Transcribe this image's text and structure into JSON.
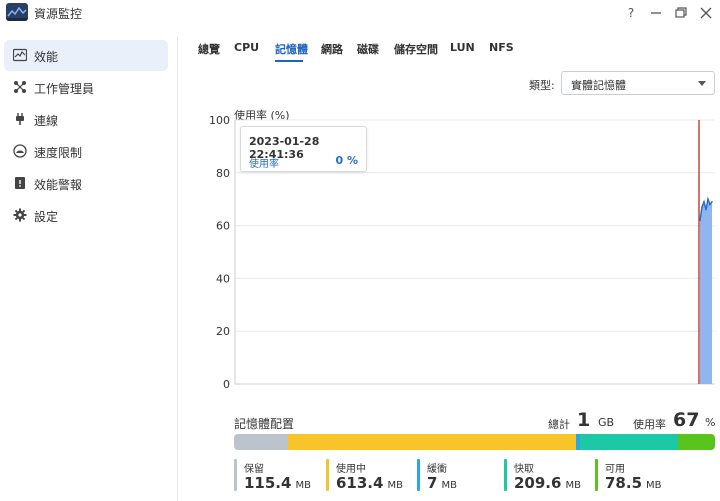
{
  "window": {
    "title": "資源監控",
    "controls": {
      "help": "?",
      "minimize": "—",
      "restore": "❐",
      "close": "✕"
    }
  },
  "sidebar": {
    "items": [
      {
        "label": "效能",
        "icon": "performance-chart-icon",
        "active": true
      },
      {
        "label": "工作管理員",
        "icon": "task-manager-icon",
        "active": false
      },
      {
        "label": "連線",
        "icon": "plug-icon",
        "active": false
      },
      {
        "label": "速度限制",
        "icon": "speedometer-icon",
        "active": false
      },
      {
        "label": "效能警報",
        "icon": "alert-clipboard-icon",
        "active": false
      },
      {
        "label": "設定",
        "icon": "gear-icon",
        "active": false
      }
    ]
  },
  "tabs": [
    {
      "label": "總覽",
      "active": false
    },
    {
      "label": "CPU",
      "active": false
    },
    {
      "label": "記憶體",
      "active": true
    },
    {
      "label": "網路",
      "active": false
    },
    {
      "label": "磁碟",
      "active": false
    },
    {
      "label": "儲存空間",
      "active": false
    },
    {
      "label": "LUN",
      "active": false
    },
    {
      "label": "NFS",
      "active": false
    }
  ],
  "type_select": {
    "label": "類型:",
    "value": "實體記憶體"
  },
  "tooltip": {
    "time": "2023-01-28 22:41:36",
    "key": "使用率",
    "value": "0 %"
  },
  "chart_data": {
    "type": "area",
    "title": "",
    "ylabel": "使用率 (%)",
    "xlabel": "",
    "ylim": [
      0,
      100
    ],
    "yticks": [
      0,
      20,
      40,
      60,
      80,
      100
    ],
    "grid": true,
    "series": [
      {
        "name": "使用率",
        "color": "#2a6dd0",
        "fill": "#8fb6ef",
        "values": [
          62,
          67,
          69,
          66,
          70,
          68,
          69
        ]
      }
    ],
    "cursor_color": "#c0392b"
  },
  "allocation": {
    "title": "記憶體配置",
    "total_label": "總計",
    "total_value": "1",
    "total_unit": "GB",
    "usage_label": "使用率",
    "usage_value": "67",
    "usage_unit": "%",
    "segments": [
      {
        "label": "保留",
        "value": "115.4",
        "unit": "MB",
        "mb": 115.4,
        "color": "#bcc3cc"
      },
      {
        "label": "使用中",
        "value": "613.4",
        "unit": "MB",
        "mb": 613.4,
        "color": "#f7c42a"
      },
      {
        "label": "緩衝",
        "value": "7",
        "unit": "MB",
        "mb": 7,
        "color": "#29a8e0"
      },
      {
        "label": "快取",
        "value": "209.6",
        "unit": "MB",
        "mb": 209.6,
        "color": "#1cc9a4"
      },
      {
        "label": "可用",
        "value": "78.5",
        "unit": "MB",
        "mb": 78.5,
        "color": "#59c41e"
      }
    ]
  }
}
